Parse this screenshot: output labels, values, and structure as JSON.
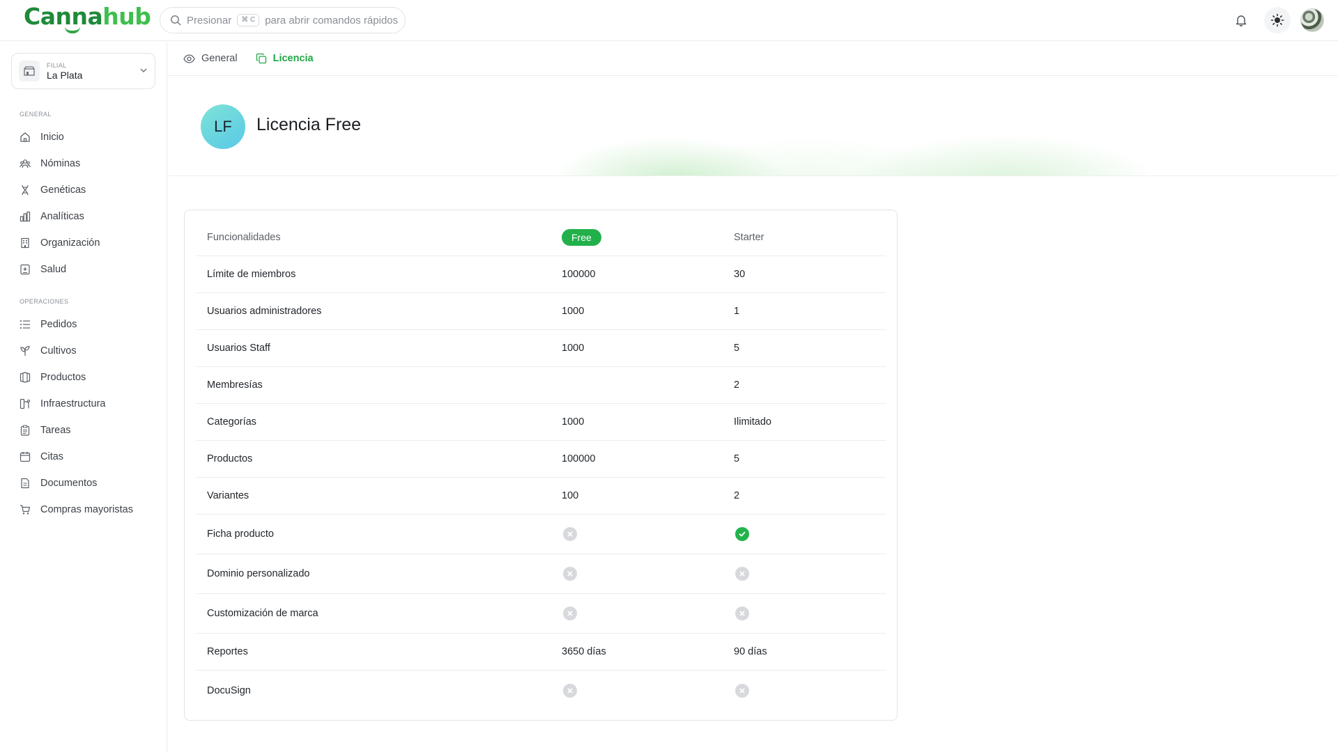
{
  "app": {
    "logo": {
      "part1": "Canna",
      "part2": "hub"
    },
    "search": {
      "prefix": "Presionar",
      "shortcut": "⌘ C",
      "suffix": "para abrir comandos rápidos"
    }
  },
  "sidebar": {
    "branch": {
      "kicker": "FILIAL",
      "name": "La Plata"
    },
    "sections": [
      {
        "title": "GENERAL",
        "items": [
          {
            "label": "Inicio",
            "icon": "home-icon"
          },
          {
            "label": "Nóminas",
            "icon": "users-icon"
          },
          {
            "label": "Genéticas",
            "icon": "dna-icon"
          },
          {
            "label": "Analíticas",
            "icon": "chart-icon"
          },
          {
            "label": "Organización",
            "icon": "building-icon"
          },
          {
            "label": "Salud",
            "icon": "health-icon"
          }
        ]
      },
      {
        "title": "OPERACIONES",
        "items": [
          {
            "label": "Pedidos",
            "icon": "list-icon"
          },
          {
            "label": "Cultivos",
            "icon": "plant-icon"
          },
          {
            "label": "Productos",
            "icon": "box-icon"
          },
          {
            "label": "Infraestructura",
            "icon": "infra-icon"
          },
          {
            "label": "Tareas",
            "icon": "clipboard-icon"
          },
          {
            "label": "Citas",
            "icon": "calendar-icon"
          },
          {
            "label": "Documentos",
            "icon": "document-icon"
          },
          {
            "label": "Compras mayoristas",
            "icon": "cart-icon"
          }
        ]
      }
    ]
  },
  "tabs": [
    {
      "label": "General",
      "icon": "eye-icon",
      "active": false
    },
    {
      "label": "Licencia",
      "icon": "copy-icon",
      "active": true
    }
  ],
  "hero": {
    "initials": "LF",
    "title": "Licencia Free"
  },
  "license_table": {
    "headers": {
      "feature": "Funcionalidades",
      "free": "Free",
      "starter": "Starter"
    },
    "rows": [
      {
        "feature": "Límite de miembros",
        "free": "100000",
        "starter": "30"
      },
      {
        "feature": "Usuarios administradores",
        "free": "1000",
        "starter": "1"
      },
      {
        "feature": "Usuarios Staff",
        "free": "1000",
        "starter": "5"
      },
      {
        "feature": "Membresías",
        "free": "",
        "starter": "2"
      },
      {
        "feature": "Categorías",
        "free": "1000",
        "starter": "Ilimitado"
      },
      {
        "feature": "Productos",
        "free": "100000",
        "starter": "5"
      },
      {
        "feature": "Variantes",
        "free": "100",
        "starter": "2"
      },
      {
        "feature": "Ficha producto",
        "free": false,
        "starter": true
      },
      {
        "feature": "Dominio personalizado",
        "free": false,
        "starter": false
      },
      {
        "feature": "Customización de marca",
        "free": false,
        "starter": false
      },
      {
        "feature": "Reportes",
        "free": "3650 días",
        "starter": "90 días"
      },
      {
        "feature": "DocuSign",
        "free": false,
        "starter": false
      }
    ]
  },
  "colors": {
    "accent": "#21b04a",
    "brand_dark": "#1f8a3a",
    "brand_light": "#3fbf4e"
  }
}
